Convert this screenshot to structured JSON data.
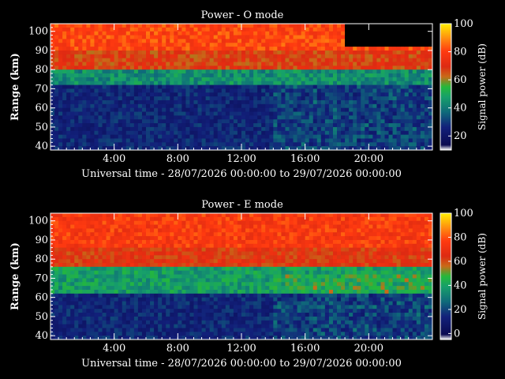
{
  "chart_data": [
    {
      "type": "heatmap",
      "title": "Power - O mode",
      "xlabel": "Universal time - 28/07/2026 00:00:00 to 29/07/2026 00:00:00",
      "ylabel": "Range (km)",
      "colorbar_label": "Signal power (dB)",
      "x_ticks": [
        "4:00",
        "8:00",
        "12:00",
        "16:00",
        "20:00"
      ],
      "x_tick_hours": [
        4,
        8,
        12,
        16,
        20
      ],
      "xlim_hours": [
        0,
        24
      ],
      "y_ticks": [
        "40",
        "50",
        "60",
        "70",
        "80",
        "90",
        "100"
      ],
      "ylim": [
        38,
        104
      ],
      "colorbar_ticks": [
        "20",
        "40",
        "60",
        "80",
        "100"
      ],
      "colorbar_range": [
        10,
        100
      ],
      "bands": [
        {
          "range_km": [
            38,
            72
          ],
          "power_db": 15
        },
        {
          "range_km": [
            72,
            80
          ],
          "power_db": 35
        },
        {
          "range_km": [
            80,
            90
          ],
          "power_db": 60
        },
        {
          "range_km": [
            90,
            104
          ],
          "power_db": 75
        }
      ],
      "blank_top_hours": [
        18.5,
        24
      ],
      "blank_top_above_km": 92
    },
    {
      "type": "heatmap",
      "title": "Power - E mode",
      "xlabel": "Universal time - 28/07/2026 00:00:00 to 29/07/2026 00:00:00",
      "ylabel": "Range (km)",
      "colorbar_label": "Signal power (dB)",
      "x_ticks": [
        "4:00",
        "8:00",
        "12:00",
        "16:00",
        "20:00"
      ],
      "x_tick_hours": [
        4,
        8,
        12,
        16,
        20
      ],
      "xlim_hours": [
        0,
        24
      ],
      "y_ticks": [
        "40",
        "50",
        "60",
        "70",
        "80",
        "90",
        "100"
      ],
      "ylim": [
        38,
        104
      ],
      "colorbar_ticks": [
        "0",
        "20",
        "40",
        "60",
        "80",
        "100"
      ],
      "colorbar_range": [
        -5,
        100
      ],
      "bands": [
        {
          "range_km": [
            38,
            62
          ],
          "power_db": 15
        },
        {
          "range_km": [
            62,
            76
          ],
          "power_db": 38
        },
        {
          "range_km": [
            76,
            86
          ],
          "power_db": 62
        },
        {
          "range_km": [
            86,
            104
          ],
          "power_db": 72
        }
      ],
      "blank_top_hours": [],
      "blank_top_above_km": 104
    }
  ]
}
